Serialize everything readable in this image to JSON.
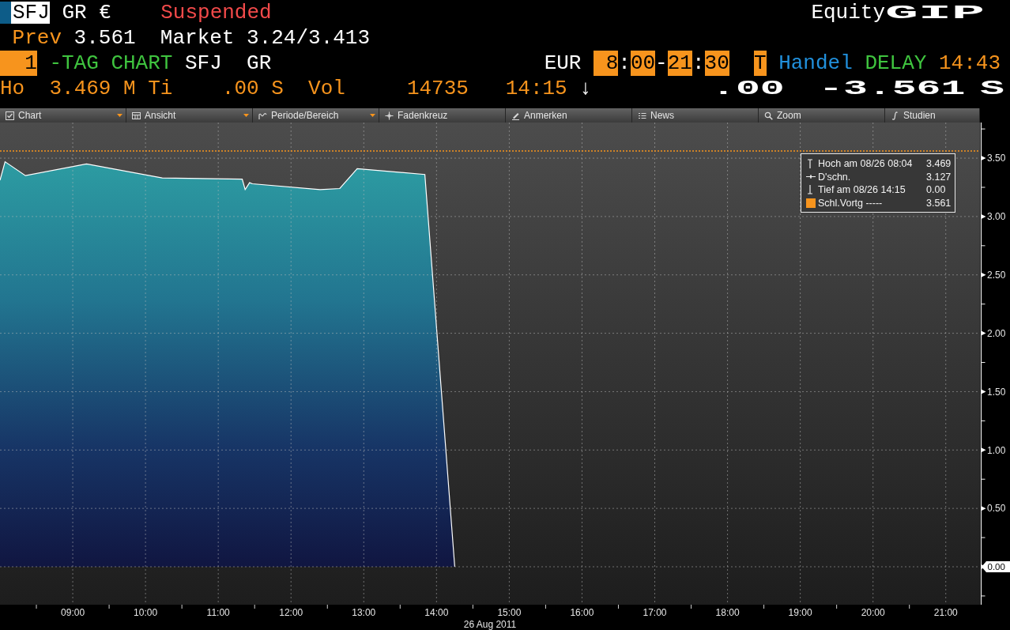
{
  "header": {
    "line_1": {
      "ticker": "SFJ",
      "exchange": "GR",
      "currency_symbol": "€",
      "status": "Suspended",
      "security_type": "Equity",
      "function_code": "GIP"
    },
    "line_2": {
      "prev_label": "Prev",
      "prev_value": "3.561",
      "market_label": "Market",
      "market_value": "3.24/3.413"
    },
    "line_3": {
      "page_number": "1",
      "title": "-TAG CHART",
      "ticker": "SFJ",
      "exchange": "GR",
      "currency": "EUR",
      "trading_hours": [
        {
          "text": "8",
          "highlighted": true
        },
        {
          "text": ":",
          "highlighted": false
        },
        {
          "text": "00",
          "highlighted": true
        },
        {
          "text": "-",
          "highlighted": false
        },
        {
          "text": "21",
          "highlighted": true
        },
        {
          "text": ":",
          "highlighted": false
        },
        {
          "text": "30",
          "highlighted": true
        }
      ],
      "session_flag": "T",
      "market_state": "Handel",
      "feed": "DELAY",
      "time": "14:43"
    },
    "line_4": {
      "high_label": "Ho",
      "high_value": "3.469",
      "high_flag": "M",
      "low_label": "Ti",
      "low_value": ".00",
      "low_flag": "S",
      "volume_label": "Vol",
      "volume_value": "14735",
      "last_time": "14:15",
      "direction": "↓",
      "last_price": ".00",
      "net_change": "-3.561",
      "change_flag": "S"
    }
  },
  "toolbar": [
    {
      "label": "Chart",
      "dropdown": true
    },
    {
      "label": "Ansicht",
      "dropdown": true
    },
    {
      "label": "Periode/Bereich",
      "dropdown": true
    },
    {
      "label": "Fadenkreuz",
      "dropdown": false
    },
    {
      "label": "Anmerken",
      "dropdown": false
    },
    {
      "label": "News",
      "dropdown": false
    },
    {
      "label": "Zoom",
      "dropdown": false
    },
    {
      "label": "Studien",
      "dropdown": false
    }
  ],
  "chart": {
    "chart_data": {
      "type": "area",
      "x": [
        8,
        8.07,
        8.35,
        9.19,
        10.23,
        11.33,
        11.37,
        11.43,
        11.47,
        12.4,
        12.67,
        12.91,
        13.84,
        14.25
      ],
      "values": [
        3.31,
        3.469,
        3.35,
        3.45,
        3.33,
        3.32,
        3.23,
        3.29,
        3.28,
        3.23,
        3.24,
        3.41,
        3.36,
        0
      ],
      "xlim": [
        8,
        21.47
      ],
      "ylim": [
        -0.325,
        3.805
      ],
      "xticks": [
        {
          "value": 9,
          "label": "09:00"
        },
        {
          "value": 10,
          "label": "10:00"
        },
        {
          "value": 11,
          "label": "11:00"
        },
        {
          "value": 12,
          "label": "12:00"
        },
        {
          "value": 13,
          "label": "13:00"
        },
        {
          "value": 14,
          "label": "14:00"
        },
        {
          "value": 15,
          "label": "15:00"
        },
        {
          "value": 16,
          "label": "16:00"
        },
        {
          "value": 17,
          "label": "17:00"
        },
        {
          "value": 18,
          "label": "18:00"
        },
        {
          "value": 19,
          "label": "19:00"
        },
        {
          "value": 20,
          "label": "20:00"
        },
        {
          "value": 21,
          "label": "21:00"
        }
      ],
      "yticks": [
        {
          "value": 0,
          "label": "0.00"
        },
        {
          "value": 0.5,
          "label": "0.50"
        },
        {
          "value": 1,
          "label": "1.00"
        },
        {
          "value": 1.5,
          "label": "1.50"
        },
        {
          "value": 2,
          "label": "2.00"
        },
        {
          "value": 2.5,
          "label": "2.50"
        },
        {
          "value": 3,
          "label": "3.00"
        },
        {
          "value": 3.5,
          "label": "3.50"
        }
      ],
      "xlabel": "26 Aug 2011",
      "grid": true,
      "ref_lines": [
        {
          "axis": "y",
          "value": 3.561,
          "color": "#f7941d"
        }
      ]
    },
    "legend": [
      {
        "kind": "high",
        "label": "Hoch am 08/26 08:04",
        "value": "3.469"
      },
      {
        "kind": "average",
        "label": "D'schn.",
        "value": "3.127"
      },
      {
        "kind": "low",
        "label": "Tief am 08/26 14:15",
        "value": "0.00"
      },
      {
        "kind": "prev_close",
        "label": "Schl.Vortg -----",
        "value": "3.561",
        "color": "#f7941d"
      }
    ]
  }
}
